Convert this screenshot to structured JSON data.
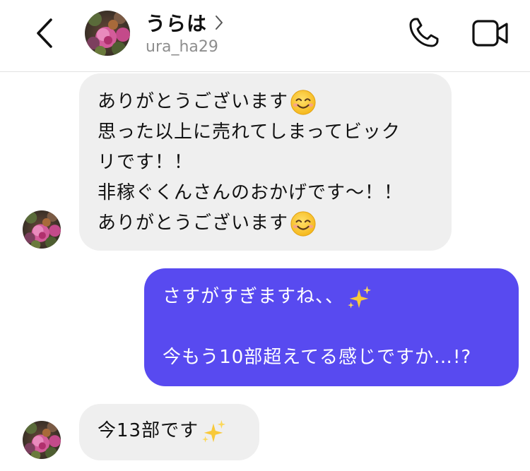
{
  "header": {
    "contact_name": "うらは",
    "username": "ura_ha29",
    "icons": {
      "back": "chevron-left-icon",
      "chevron": "chevron-right-icon",
      "call": "phone-icon",
      "video": "video-camera-icon"
    }
  },
  "messages": [
    {
      "direction": "incoming",
      "lines": [
        {
          "text": "ありがとうございます",
          "emoji": "smiling-face-icon"
        },
        {
          "text": "思った以上に売れてしまってビック"
        },
        {
          "text": "リです！！"
        },
        {
          "text": "非稼ぐくんさんのおかげです〜！！"
        },
        {
          "text": "ありがとうございます",
          "emoji": "smiling-face-icon"
        }
      ]
    },
    {
      "direction": "outgoing",
      "lines": [
        {
          "text": "さすがすぎますね、、",
          "emoji": "sparkles-icon"
        },
        {
          "text": ""
        },
        {
          "text": "今もう10部超えてる感じですか…!?"
        }
      ]
    },
    {
      "direction": "incoming",
      "lines": [
        {
          "text": "今13部です",
          "emoji": "sparkles-icon"
        }
      ]
    }
  ],
  "colors": {
    "outgoing_bubble": "#584af0",
    "incoming_bubble": "#efefef",
    "username_gray": "#8e8e8e",
    "divider": "#e2e2e2"
  }
}
